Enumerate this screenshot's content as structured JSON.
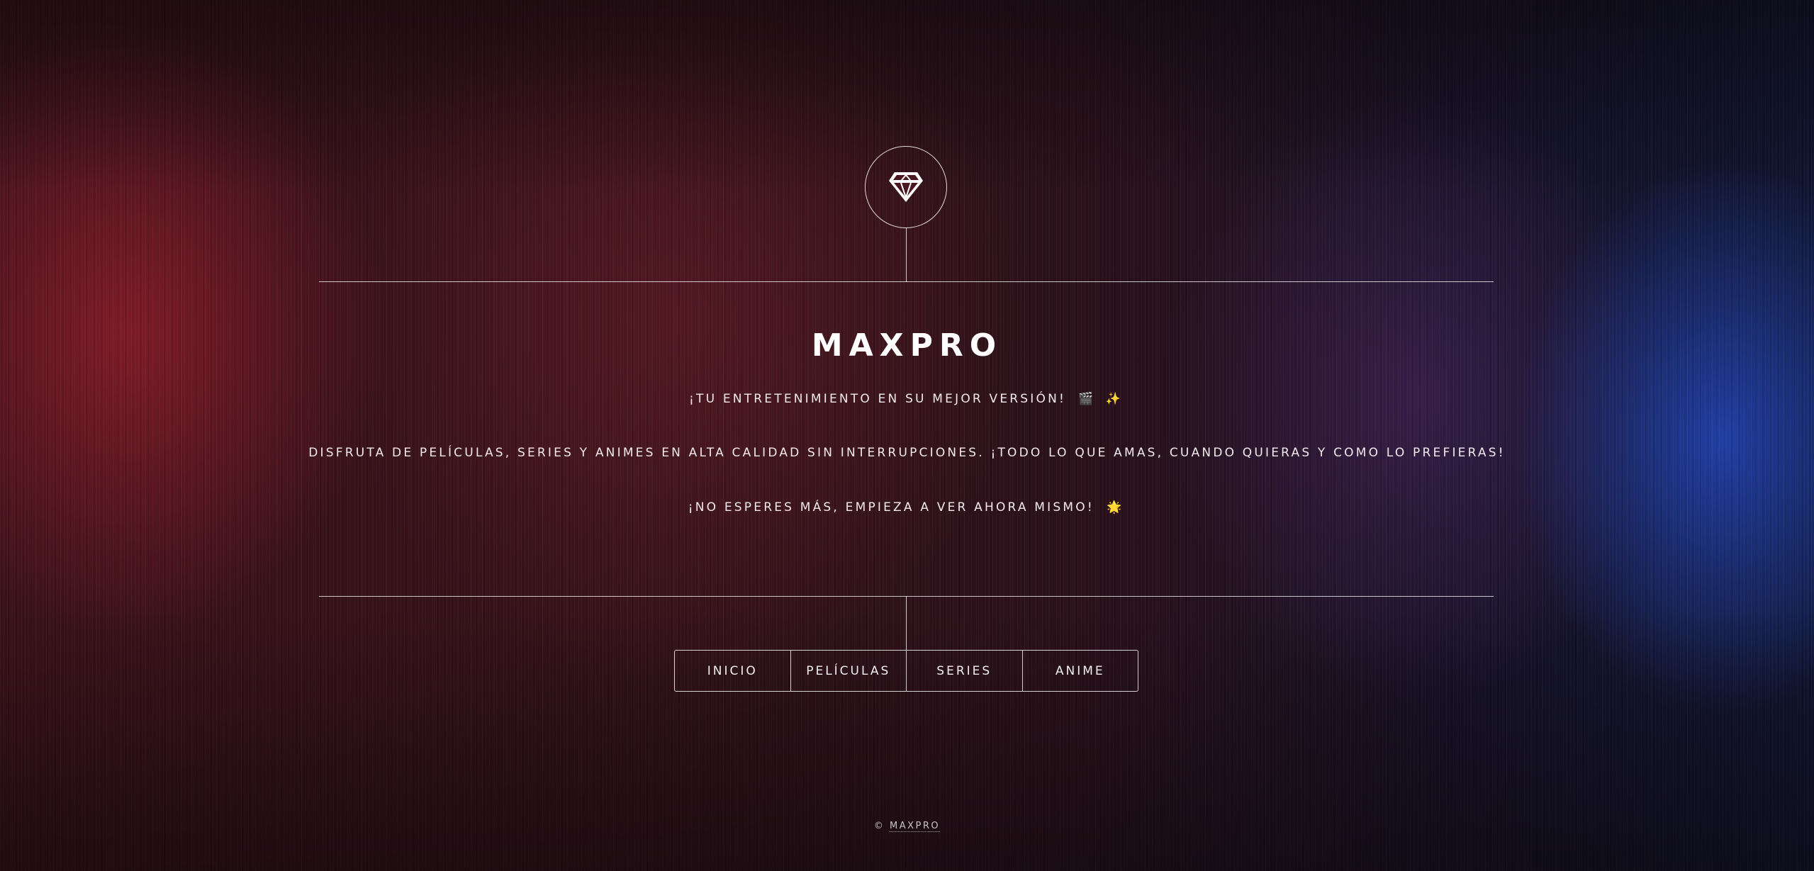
{
  "header": {
    "logo_icon": "diamond-icon",
    "title": "MAXPRO"
  },
  "content": {
    "tagline_text": "¡TU ENTRETENIMIENTO EN SU MEJOR VERSIÓN!",
    "tagline_emoji": "🎬 ✨",
    "description": "DISFRUTA DE PELÍCULAS, SERIES Y ANIMES EN ALTA CALIDAD SIN INTERRUPCIONES. ¡TODO LO QUE AMAS, CUANDO QUIERAS Y COMO LO PREFIERAS!",
    "cta_text": "¡NO ESPERES MÁS, EMPIEZA A VER AHORA MISMO!",
    "cta_emoji": "🌟"
  },
  "nav": {
    "items": [
      {
        "label": "INICIO"
      },
      {
        "label": "PELÍCULAS"
      },
      {
        "label": "SERIES"
      },
      {
        "label": "ANIME"
      }
    ]
  },
  "footer": {
    "copyright_symbol": "©",
    "brand_link": "MAXPRO"
  },
  "colors": {
    "accent_red": "#96202d",
    "accent_blue": "#2346b9",
    "text": "#f3eef0"
  }
}
